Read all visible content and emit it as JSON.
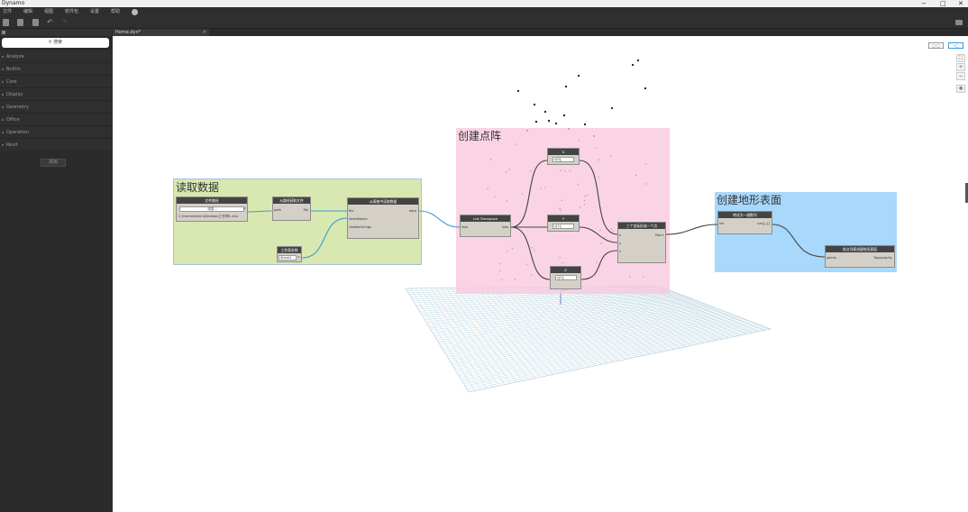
{
  "window": {
    "title": "Dynamo",
    "controls": [
      "−",
      "□",
      "✕"
    ]
  },
  "menu": [
    "文件",
    "编辑",
    "视图",
    "软件包",
    "设置",
    "帮助"
  ],
  "library": {
    "search_placeholder": "搜索",
    "categories": [
      "Analyze",
      "Builtin",
      "Core",
      "Display",
      "Geometry",
      "Office",
      "Operation",
      "Revit"
    ],
    "add_label": "添加"
  },
  "tab": {
    "label": "Home.dyn*",
    "close": "✕"
  },
  "canvas": {
    "mode_buttons": [
      "□-□",
      "→□"
    ],
    "nav": [
      "⛶",
      "+",
      "−",
      "✚"
    ],
    "groups": [
      {
        "title": "读取数据",
        "color": "#d8e8b0"
      },
      {
        "title": "创建点阵",
        "color": "#f9d6e6"
      },
      {
        "title": "创建地形表面",
        "color": "#a8d8fb"
      }
    ],
    "nodes": {
      "file_path": {
        "title": "文件路径",
        "button": "浏览...",
        "value": "C:\\Users\\Admin\\Desktop\\工作簿1.xlsx"
      },
      "file_from_path": {
        "title": "从路径获取文件",
        "in": "path",
        "out": "file"
      },
      "sheet_name": {
        "title": "工作表名称",
        "value": "Sheet1"
      },
      "excel_read": {
        "title": "从表格中读取数据",
        "ins": [
          "file",
          "sheetName",
          "readAsStrings"
        ],
        "out": "data"
      },
      "list_transpose": {
        "title": "List.Transpose",
        "in": "lists",
        "out": "lists"
      },
      "x": {
        "title": "X",
        "value": "x[0];"
      },
      "y": {
        "title": "Y",
        "value": "y[1];"
      },
      "z": {
        "title": "Z",
        "value": "z[2];"
      },
      "point_by_coords": {
        "title": "三个坐标形成一个点",
        "ins": [
          "x",
          "y",
          "z"
        ],
        "out": "Point"
      },
      "flatten": {
        "title": "转化为一维数列",
        "in": "list",
        "out": "var[]..[]"
      },
      "topo_from_points": {
        "title": "依点列表创建地形表面",
        "in": "points",
        "out": "Topography"
      }
    }
  }
}
